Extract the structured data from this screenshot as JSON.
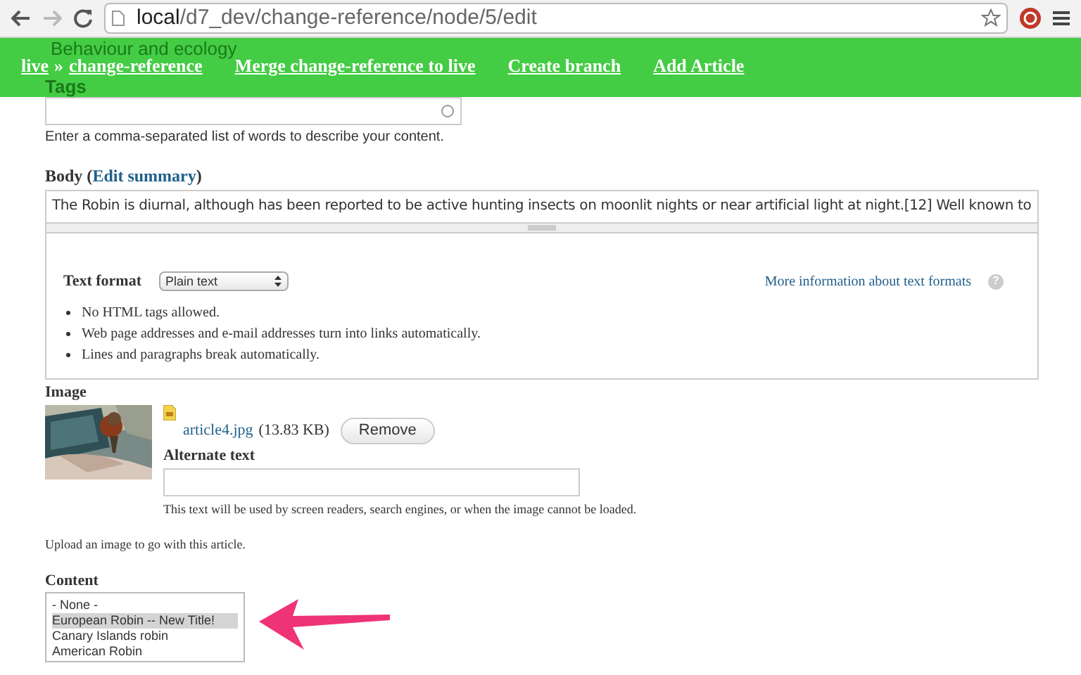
{
  "browser": {
    "url_host": "local",
    "url_path": "/d7_dev/change-reference/node/5/edit"
  },
  "toolbar": {
    "behind_text": "Behaviour and ecology",
    "links": [
      {
        "parts": [
          "live",
          "»",
          "change-reference"
        ]
      },
      {
        "parts": [
          "Merge change-reference to live"
        ]
      },
      {
        "parts": [
          "Create branch"
        ]
      },
      {
        "parts": [
          "Add Article"
        ]
      }
    ]
  },
  "tags": {
    "label": "Tags",
    "help": "Enter a comma-separated list of words to describe your content."
  },
  "body": {
    "label": "Body (",
    "link": "Edit summary",
    "label_end": ")",
    "value": "The Robin is diurnal, although has been reported to be active hunting insects on moonlit nights or near artificial light at night.[12] Well known to",
    "text_format": {
      "label": "Text format",
      "value": "Plain text",
      "more_link": "More information about text formats",
      "help_icon": "?",
      "tips": [
        "No HTML tags allowed.",
        "Web page addresses and e-mail addresses turn into links automatically.",
        "Lines and paragraphs break automatically."
      ]
    }
  },
  "image": {
    "label": "Image",
    "file_name": "article4.jpg",
    "file_size": "(13.83 KB)",
    "remove_button": "Remove",
    "alt_label": "Alternate text",
    "alt_help": "This text will be used by screen readers, search engines, or when the image cannot be loaded.",
    "help": "Upload an image to go with this article."
  },
  "content": {
    "label": "Content",
    "options": [
      {
        "label": "- None -",
        "selected": false
      },
      {
        "label": "European Robin -- New Title!",
        "selected": true
      },
      {
        "label": "Canary Islands robin",
        "selected": false
      },
      {
        "label": "American Robin",
        "selected": false
      }
    ]
  }
}
